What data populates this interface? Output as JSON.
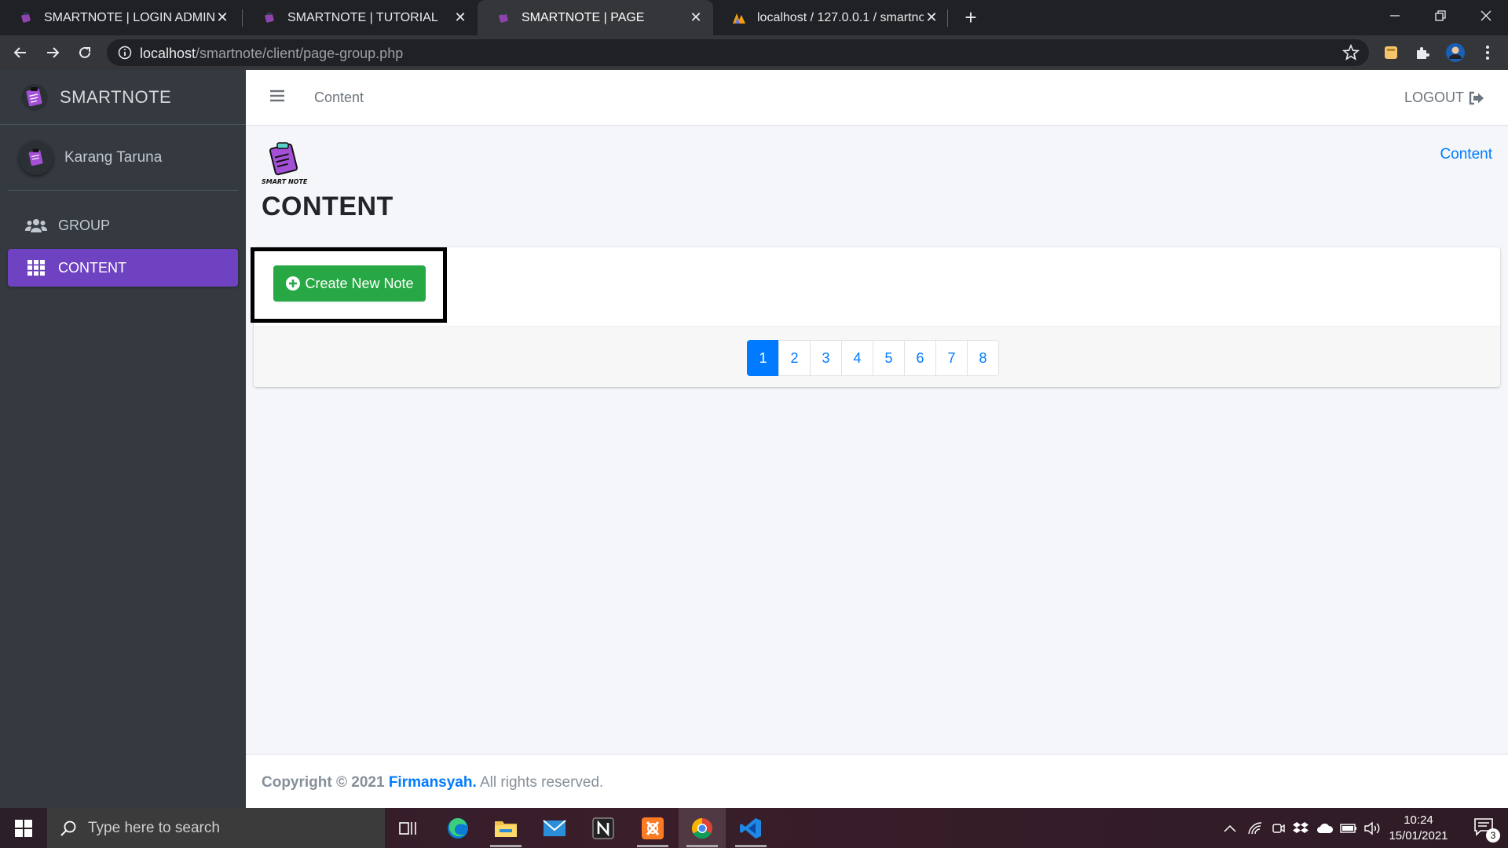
{
  "browser": {
    "tabs": [
      {
        "title": "SMARTNOTE | LOGIN ADMIN",
        "close": "✕"
      },
      {
        "title": "SMARTNOTE | TUTORIAL",
        "close": "✕"
      },
      {
        "title": "SMARTNOTE | PAGE",
        "close": "✕",
        "active": true
      },
      {
        "title": "localhost / 127.0.0.1 / smartnote",
        "close": "✕"
      }
    ],
    "new_tab": "+",
    "url_host": "localhost",
    "url_path": "/smartnote/client/page-group.php"
  },
  "sidebar": {
    "brand": "SMARTNOTE",
    "user": "Karang Taruna",
    "items": [
      {
        "label": "GROUP",
        "icon": "users-icon"
      },
      {
        "label": "CONTENT",
        "icon": "grid-icon",
        "active": true
      }
    ]
  },
  "navbar": {
    "link": "Content",
    "logout": "LOGOUT"
  },
  "page": {
    "logo_text": "SMART NOTE",
    "title": "CONTENT",
    "breadcrumb": "Content",
    "create_button": "Create New Note",
    "pages": [
      "1",
      "2",
      "3",
      "4",
      "5",
      "6",
      "7",
      "8"
    ],
    "active_page": "1"
  },
  "footer": {
    "copyright": "Copyright © 2021",
    "author": "Firmansyah.",
    "rights": "All rights reserved."
  },
  "taskbar": {
    "search_placeholder": "Type here to search",
    "time": "10:24",
    "date": "15/01/2021",
    "notifications": "3"
  },
  "colors": {
    "sidebar_bg": "#343a40",
    "active_nav": "#6f42c1",
    "success": "#28a745",
    "primary": "#007bff"
  }
}
